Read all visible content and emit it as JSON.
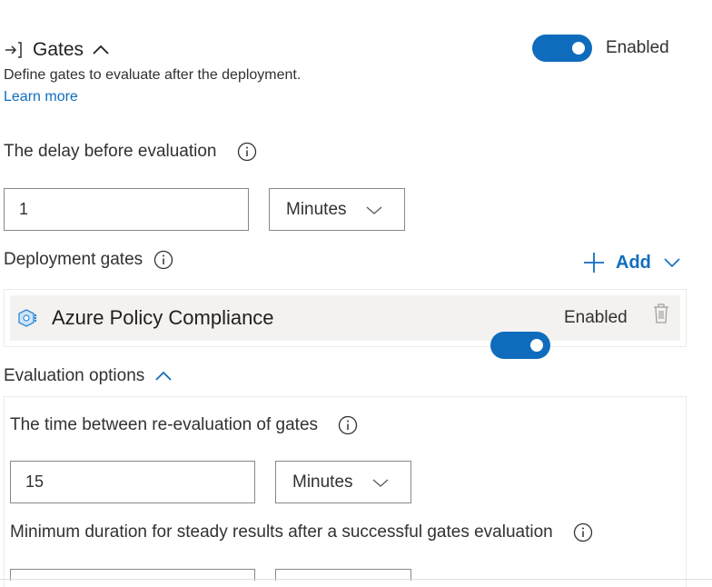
{
  "header": {
    "title": "Gates",
    "enabled_label": "Enabled",
    "description": "Define gates to evaluate after the deployment.",
    "learn_more": "Learn more"
  },
  "delay": {
    "label": "The delay before evaluation",
    "value": "1",
    "unit": "Minutes"
  },
  "deployment_gates": {
    "label": "Deployment gates",
    "add_label": "Add",
    "items": [
      {
        "name": "Azure Policy Compliance",
        "status": "Enabled"
      }
    ]
  },
  "evaluation_options": {
    "label": "Evaluation options",
    "reevaluation": {
      "label": "The time between re-evaluation of gates",
      "value": "15",
      "unit": "Minutes"
    },
    "steady": {
      "label": "Minimum duration for steady results after a successful gates evaluation"
    }
  },
  "colors": {
    "accent": "#0f6cbd",
    "link": "#106ebe",
    "text": "#323130"
  }
}
